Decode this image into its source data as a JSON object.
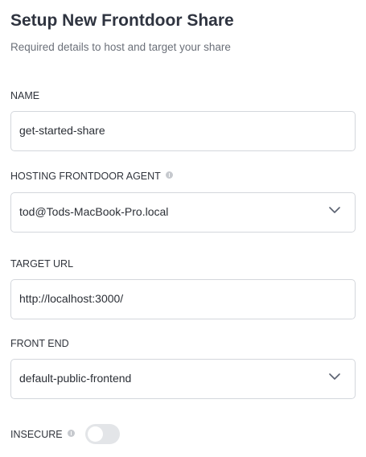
{
  "header": {
    "title": "Setup New Frontdoor Share",
    "subtitle": "Required details to host and target your share"
  },
  "form": {
    "name": {
      "label": "NAME",
      "value": "get-started-share"
    },
    "hosting_agent": {
      "label": "HOSTING FRONTDOOR AGENT",
      "value": "tod@Tods-MacBook-Pro.local",
      "icon": "info-icon"
    },
    "target_url": {
      "label": "TARGET URL",
      "value": "http://localhost:3000/"
    },
    "front_end": {
      "label": "FRONT END",
      "value": "default-public-frontend"
    },
    "insecure": {
      "label": "INSECURE",
      "enabled": false,
      "icon": "info-icon"
    }
  },
  "colors": {
    "border": "#d4d7dc",
    "toggle_off": "#e3e5e8",
    "info_icon": "#c6c9ce"
  }
}
